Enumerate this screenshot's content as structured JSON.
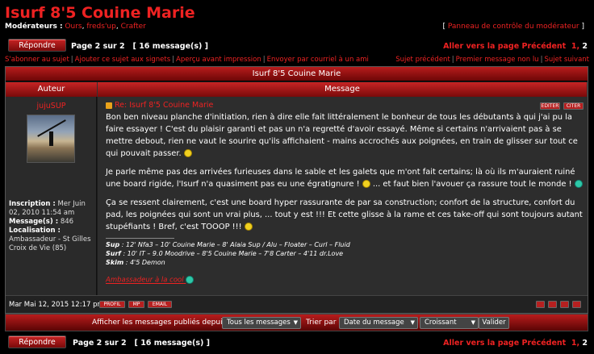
{
  "topic": {
    "title": "Isurf 8'5 Couine Marie",
    "moderators_label": "Modérateurs :",
    "moderators": [
      "Ours",
      "freds'up",
      "Crafter"
    ],
    "mod_panel": "Panneau de contrôle du modérateur"
  },
  "nav": {
    "reply_label": "Répondre",
    "page_info": "Page 2 sur 2",
    "message_count": "[ 16 message(s) ]",
    "goto_label": "Aller vers la page",
    "prev_label": "Précédent",
    "pages": [
      "1",
      "2"
    ]
  },
  "links": {
    "left": [
      "S'abonner au sujet",
      "Ajouter ce sujet aux signets",
      "Aperçu avant impression",
      "Envoyer par courriel à un ami"
    ],
    "right": [
      "Sujet précédent",
      "Premier message non lu",
      "Sujet suivant"
    ]
  },
  "table": {
    "header": "Isurf 8'5 Couine Marie",
    "col_author": "Auteur",
    "col_message": "Message"
  },
  "post": {
    "author": "jujuSUP",
    "title": "Re: Isurf 8'5 Couine Marie",
    "edit_label": "EDITER",
    "quote_label": "CITER",
    "profile": [
      {
        "k": "Inscription :",
        "v": "Mer Juin 02, 2010 11:54 am"
      },
      {
        "k": "Message(s) :",
        "v": "846"
      },
      {
        "k": "Localisation :",
        "v": "Ambassadeur - St Gilles Croix de Vie (85)"
      }
    ],
    "p1": "Bon ben niveau planche d'initiation, rien à dire elle fait littéralement le bonheur de tous les débutants à qui j'ai pu la faire essayer ! C'est du plaisir garanti et pas un n'a regretté d'avoir essayé. Même si certains n'arrivaient pas à se mettre debout, rien ne vaut le sourire qu'ils affichaient - mains accrochés aux poignées, en train de glisser sur tout ce qui pouvait passer.",
    "p2a": "Je parle même pas des arrivées furieuses dans le sable et les galets que m'ont fait certains; là où ils m'auraient ruiné une board rigide, l'Isurf n'a quasiment pas eu une égratignure !",
    "p2b": "... et faut bien l'avouer ça rassure tout le monde !",
    "p3": "Ça se ressent clairement, c'est une board hyper rassurante de par sa construction; confort de la structure, confort du pad, les poignées qui sont un vrai plus, ... tout y est !!! Et cette glisse à la rame et ces take-off qui sont toujours autant stupéfiants ! Bref, c'est TOOOP !!!",
    "sig": [
      {
        "k": "Sup",
        "v": ": 12' Nfa3 – 10' Couine Marie – 8' Alaia Sup / Alu – Floater – Curl – Fluid"
      },
      {
        "k": "Surf",
        "v": ": 10' IT – 9.0 Moodrive – 8'5 Couine Marie – 7'8 Carter – 4'11 dr.Love"
      },
      {
        "k": "Skim",
        "v": ": 4'5 Demon"
      }
    ],
    "sig_link": "Ambassadeur à la cool",
    "date": "Mar Mai 12, 2015 12:17 pm",
    "btn_profile": "PROFIL",
    "btn_mp": "MP",
    "btn_email": "EMAIL"
  },
  "filter": {
    "label": "Afficher les messages publiés depuis :",
    "since": "Tous les messages",
    "sort_label": "Trier par",
    "sort_by": "Date du message",
    "order": "Croissant",
    "submit": "Valider"
  },
  "colors": {
    "accent": "#e22222",
    "bar_top": "#c62424",
    "bar_bottom": "#7a0a0a"
  }
}
